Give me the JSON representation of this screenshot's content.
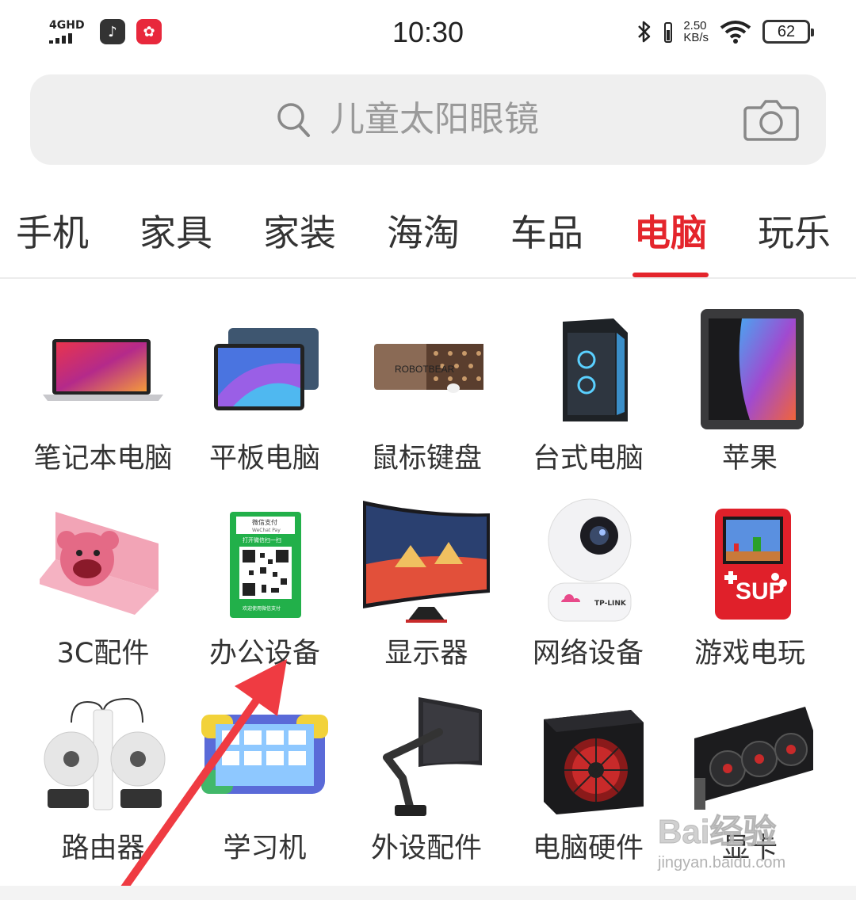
{
  "status_bar": {
    "network_label": "4GHD",
    "time": "10:30",
    "speed_value": "2.50",
    "speed_unit": "KB/s",
    "battery": "62",
    "icons": [
      "signal-icon",
      "music-app-icon",
      "red-app-icon",
      "bluetooth-icon",
      "wifi-icon",
      "battery-icon"
    ]
  },
  "search": {
    "placeholder": "儿童太阳眼镜",
    "icons": [
      "search-icon",
      "camera-icon"
    ]
  },
  "tabs": [
    {
      "label": "手机",
      "active": false
    },
    {
      "label": "家具",
      "active": false
    },
    {
      "label": "家装",
      "active": false
    },
    {
      "label": "海淘",
      "active": false
    },
    {
      "label": "车品",
      "active": false
    },
    {
      "label": "电脑",
      "active": true
    },
    {
      "label": "玩乐",
      "active": false
    }
  ],
  "categories": [
    {
      "label": "笔记本电脑",
      "icon": "laptop-icon"
    },
    {
      "label": "平板电脑",
      "icon": "tablet-icon"
    },
    {
      "label": "鼠标键盘",
      "icon": "mouse-pad-icon"
    },
    {
      "label": "台式电脑",
      "icon": "desktop-pc-icon"
    },
    {
      "label": "苹果",
      "icon": "ipad-icon"
    },
    {
      "label": "3C配件",
      "icon": "laptop-skin-icon"
    },
    {
      "label": "办公设备",
      "icon": "qr-payment-stand-icon"
    },
    {
      "label": "显示器",
      "icon": "monitor-icon"
    },
    {
      "label": "网络设备",
      "icon": "security-camera-icon"
    },
    {
      "label": "游戏电玩",
      "icon": "handheld-console-icon"
    },
    {
      "label": "路由器",
      "icon": "wifi-antenna-icon"
    },
    {
      "label": "学习机",
      "icon": "learning-tablet-icon"
    },
    {
      "label": "外设配件",
      "icon": "monitor-arm-icon"
    },
    {
      "label": "电脑硬件",
      "icon": "power-supply-icon"
    },
    {
      "label": "显卡",
      "icon": "graphics-card-icon"
    }
  ],
  "embedded_text": {
    "mousepad_brand": "ROBOTBEAR",
    "qr_stand_title": "微信支付",
    "qr_stand_subtitle": "WeChat Pay",
    "qr_stand_instruction": "打开微信扫一扫",
    "qr_stand_footer": "欢迎使用微信支付",
    "camera_brand": "TP-LINK",
    "console_badge": "SUP"
  },
  "watermark": {
    "text": "Bai经验",
    "url": "jingyan.baidu.com"
  },
  "colors": {
    "accent": "#e4252c",
    "search_bg": "#efefef",
    "text": "#333333",
    "arrow": "#ef3b42"
  }
}
